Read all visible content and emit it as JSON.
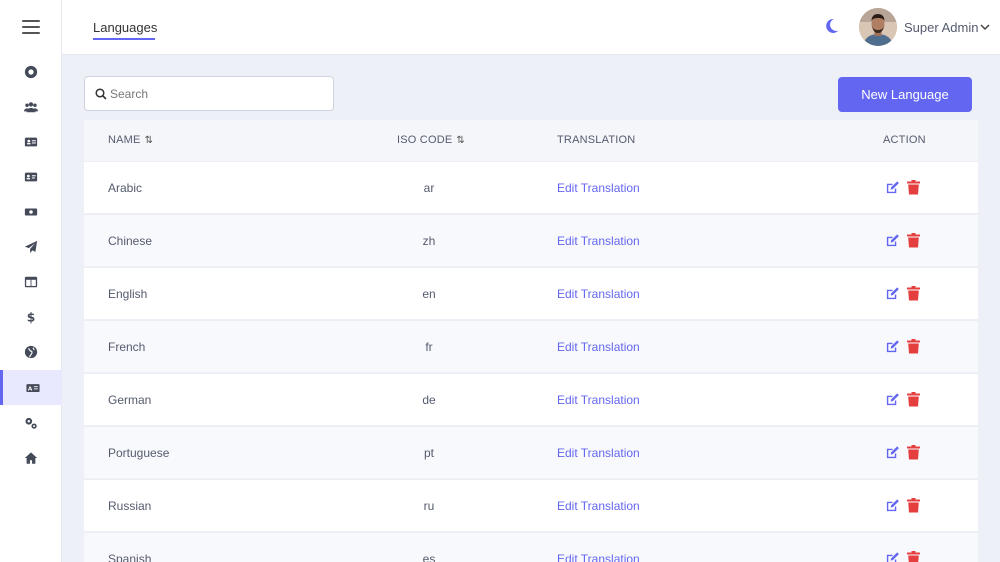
{
  "header": {
    "page_tab": "Languages",
    "user_name": "Super Admin"
  },
  "sidebar": {
    "items": [
      {
        "icon": "circle-dot-icon"
      },
      {
        "icon": "users-icon"
      },
      {
        "icon": "id-card-icon"
      },
      {
        "icon": "address-card-icon"
      },
      {
        "icon": "money-bill-icon"
      },
      {
        "icon": "paper-plane-icon"
      },
      {
        "icon": "columns-icon"
      },
      {
        "icon": "dollar-icon"
      },
      {
        "icon": "globe-icon"
      },
      {
        "icon": "language-icon",
        "active": true
      },
      {
        "icon": "cogs-icon"
      },
      {
        "icon": "home-icon"
      }
    ]
  },
  "toolbar": {
    "search_placeholder": "Search",
    "new_button": "New Language"
  },
  "table": {
    "columns": [
      "NAME",
      "ISO CODE",
      "TRANSLATION",
      "ACTION"
    ],
    "rows": [
      {
        "name": "Arabic",
        "iso": "ar",
        "translation": "Edit Translation"
      },
      {
        "name": "Chinese",
        "iso": "zh",
        "translation": "Edit Translation"
      },
      {
        "name": "English",
        "iso": "en",
        "translation": "Edit Translation"
      },
      {
        "name": "French",
        "iso": "fr",
        "translation": "Edit Translation"
      },
      {
        "name": "German",
        "iso": "de",
        "translation": "Edit Translation"
      },
      {
        "name": "Portuguese",
        "iso": "pt",
        "translation": "Edit Translation"
      },
      {
        "name": "Russian",
        "iso": "ru",
        "translation": "Edit Translation"
      },
      {
        "name": "Spanish",
        "iso": "es",
        "translation": "Edit Translation"
      }
    ]
  },
  "colors": {
    "accent": "#6366f1",
    "danger": "#e53e3e"
  }
}
